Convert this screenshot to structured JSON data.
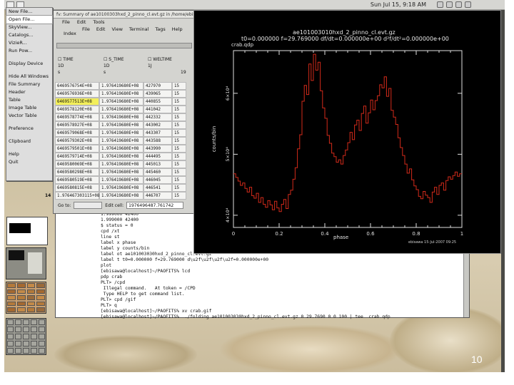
{
  "top_panel": {
    "clock": "Sun Jul 15,  9:18 AM"
  },
  "app_menu": {
    "items": [
      "New File...",
      "Open File...",
      "SkyView...",
      "Catalogs...",
      "VizieR...",
      "Run Pow...",
      "",
      "Display Device",
      "",
      "Hide All Windows",
      "File Summary",
      "Header",
      "Table",
      "Image Table",
      "Vector Table",
      "",
      "Preference",
      "",
      "Clipboard",
      "",
      "Help",
      "Quit"
    ]
  },
  "fv_window": {
    "title": "fv: Summary of ae10100303hxd_2_pinno_cl.evt.gz in /home/ebisawa/WLPFOTS Window 3",
    "menubar": [
      "File",
      "Edit",
      "Tools"
    ],
    "menubar2": [
      "File",
      "Edit",
      "View",
      "Terminal",
      "Tags",
      "Help"
    ],
    "index_label": "Index",
    "columns": [
      {
        "name": "TIME",
        "unit": "1D",
        "sub": "s"
      },
      {
        "name": "S_TIME",
        "unit": "1D",
        "sub": "s"
      },
      {
        "name": "WELTIME",
        "unit": "1J",
        "sub": ""
      },
      {
        "name": "",
        "unit": "",
        "sub": "19"
      }
    ],
    "rows": [
      [
        "6469576754E+08",
        "1.976419680E+08",
        "427970",
        "15"
      ],
      [
        "6469576936E+08",
        "1.976419680E+08",
        "439065",
        "15"
      ],
      [
        "6469577513E+08",
        "1.976419680E+08",
        "440855",
        "15"
      ],
      [
        "6469578120E+08",
        "1.976419680E+08",
        "441042",
        "15"
      ],
      [
        "6469578774E+08",
        "1.976419680E+08",
        "442332",
        "15"
      ],
      [
        "6469578927E+08",
        "1.976419680E+08",
        "443002",
        "15"
      ],
      [
        "6469579068E+08",
        "1.976419680E+08",
        "443307",
        "15"
      ],
      [
        "6469579302E+08",
        "1.976419680E+08",
        "443588",
        "15"
      ],
      [
        "6469579501E+08",
        "1.976419680E+08",
        "443990",
        "15"
      ],
      [
        "6469579714E+08",
        "1.976419680E+08",
        "444495",
        "15"
      ],
      [
        "6469580069E+08",
        "1.976419680E+08",
        "445013",
        "15"
      ],
      [
        "6469580298E+08",
        "1.976419680E+08",
        "445460",
        "15"
      ],
      [
        "6469580519E+08",
        "1.976419680E+08",
        "446045",
        "15"
      ],
      [
        "6469580815E+08",
        "1.976419680E+08",
        "446541",
        "15"
      ],
      [
        "1.976467303115+08",
        "1.976419680E+08",
        "446707",
        "15"
      ]
    ],
    "highlight_row": 2,
    "last_row_index": "14",
    "goto_label": "Go to:",
    "edit_label": "Edit cell:",
    "edit_value": "1976496487.761742"
  },
  "terminal": {
    "lines": [
      "1.999000 42400",
      "1.999000 42400",
      "$ status = 0",
      "cpd /xt",
      "line st",
      "label x phase",
      "label y counts/bin",
      "label ot ae101003030hxd_2_pinno_cl.evt.gz",
      "label t t0=0.000000 f=29.769000 d\\u2f\\u2f\\u2f\\u2f=0.000000e+00",
      "plot",
      "[ebisawa@localhost]~/PAOFITS% lcd",
      "pdp crab",
      "PLT> /cpd",
      " Illegal command.   At token = /CPD",
      " Type HELP to get command list.",
      "PLT> cpd /gif",
      "PLT> q",
      "[ebisawa@localhost]~/PAOFITS% xv crab.gif",
      "[ebisawa@localhost]~/PAOFITS%  ./folding ae101003030hxd_2_pinno_cl.evt.gz 0 29.7690 0 0 100 | tee  crab.qdp"
    ]
  },
  "plot_window": {
    "titlebar": "",
    "header_line1": "ae101003010hxd_2_pinno_cl.evt.gz",
    "header_line2": "t0=0.000000  f=29.769000  df/dt=0.000000e+00  d²f/dt²=0.000000e+00",
    "header_line3": "crab.qdp",
    "footer": "ebisawa 15-Jul-2007 09:25"
  },
  "chart_data": {
    "type": "line",
    "title": "",
    "xlabel": "phase",
    "ylabel": "counts/bin",
    "xlim": [
      0,
      1
    ],
    "ylim": [
      38000,
      67000
    ],
    "xticks": [
      "0",
      "0.2",
      "0.4",
      "0.6",
      "0.8",
      "1"
    ],
    "yticks": [
      "4×10⁴",
      "5×10⁴",
      "6×10⁴"
    ],
    "ytick_values": [
      40000,
      50000,
      60000
    ],
    "line_color": "#d22a1a",
    "series": [
      {
        "values": [
          46800,
          46200,
          45600,
          44900,
          45300,
          44400,
          43800,
          44600,
          43200,
          42800,
          43600,
          42100,
          42900,
          41800,
          41300,
          42400,
          41700,
          40900,
          42300,
          41200,
          40600,
          41800,
          42600,
          41100,
          43400,
          44100,
          45900,
          47800,
          50900,
          53200,
          58700,
          61300,
          59800,
          64800,
          62100,
          66400,
          63800,
          65100,
          60400,
          57600,
          55900,
          53100,
          51800,
          50200,
          49600,
          48700,
          49100,
          48400,
          49800,
          50700,
          51900,
          53600,
          52400,
          54800,
          55600,
          53900,
          56700,
          57900,
          55100,
          56800,
          58900,
          57300,
          58800,
          59600,
          61400,
          60900,
          62700,
          59500,
          60800,
          57200,
          56100,
          54900,
          52700,
          51100,
          49800,
          48400,
          46900,
          47600,
          45800,
          44800,
          44200,
          43100,
          42700,
          43900,
          43300,
          42900,
          42100,
          43800,
          44600,
          43400,
          44900,
          45300,
          44100,
          45700,
          46300,
          45900,
          46500,
          47100,
          46400,
          46800
        ]
      }
    ]
  },
  "slide": {
    "page_number": "10"
  }
}
